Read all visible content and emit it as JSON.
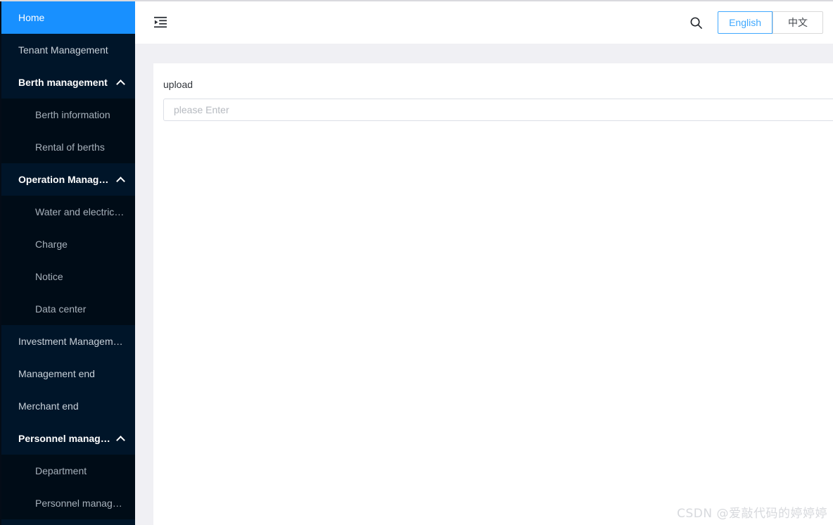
{
  "sidebar": {
    "items": [
      {
        "id": "home",
        "label": "Home",
        "level": 1,
        "state": "selected"
      },
      {
        "id": "tenant-management",
        "label": "Tenant Management",
        "level": 1,
        "state": "normal"
      },
      {
        "id": "berth-management",
        "label": "Berth management",
        "level": 1,
        "state": "open",
        "icon": "chevron-up-icon"
      },
      {
        "id": "berth-information",
        "label": "Berth information",
        "level": 2,
        "state": "normal"
      },
      {
        "id": "rental-of-berths",
        "label": "Rental of berths",
        "level": 2,
        "state": "normal"
      },
      {
        "id": "operation-management",
        "label": "Operation Managem...",
        "level": 1,
        "state": "open",
        "icon": "chevron-up-icon"
      },
      {
        "id": "water-and-electricity",
        "label": "Water and electricit...",
        "level": 2,
        "state": "normal"
      },
      {
        "id": "charge",
        "label": "Charge",
        "level": 2,
        "state": "normal"
      },
      {
        "id": "notice",
        "label": "Notice",
        "level": 2,
        "state": "normal"
      },
      {
        "id": "data-center",
        "label": "Data center",
        "level": 2,
        "state": "normal"
      },
      {
        "id": "investment-management",
        "label": "Investment Management",
        "level": 1,
        "state": "normal"
      },
      {
        "id": "management-end",
        "label": "Management end",
        "level": 1,
        "state": "normal"
      },
      {
        "id": "merchant-end",
        "label": "Merchant end",
        "level": 1,
        "state": "normal"
      },
      {
        "id": "personnel-management",
        "label": "Personnel managem...",
        "level": 1,
        "state": "open",
        "icon": "chevron-up-icon"
      },
      {
        "id": "department",
        "label": "Department",
        "level": 2,
        "state": "normal"
      },
      {
        "id": "personnel-manage",
        "label": "Personnel manage...",
        "level": 2,
        "state": "normal"
      }
    ]
  },
  "header": {
    "fold_icon": "menu-fold-icon",
    "search_icon": "search-icon",
    "languages": [
      {
        "id": "english",
        "label": "English",
        "active": true
      },
      {
        "id": "chinese",
        "label": "中文",
        "active": false
      }
    ]
  },
  "main": {
    "form": {
      "label": "upload",
      "input_value": "",
      "input_placeholder": "please Enter"
    }
  },
  "watermark": {
    "text": "CSDN @爱敲代码的婷婷婷"
  },
  "colors": {
    "sidebar_bg": "#001529",
    "submenu_bg": "#000c17",
    "accent": "#1890ff",
    "lang_active": "#40a9ff",
    "strip_bg": "#f0f0f4",
    "border": "#d9d9d9"
  }
}
